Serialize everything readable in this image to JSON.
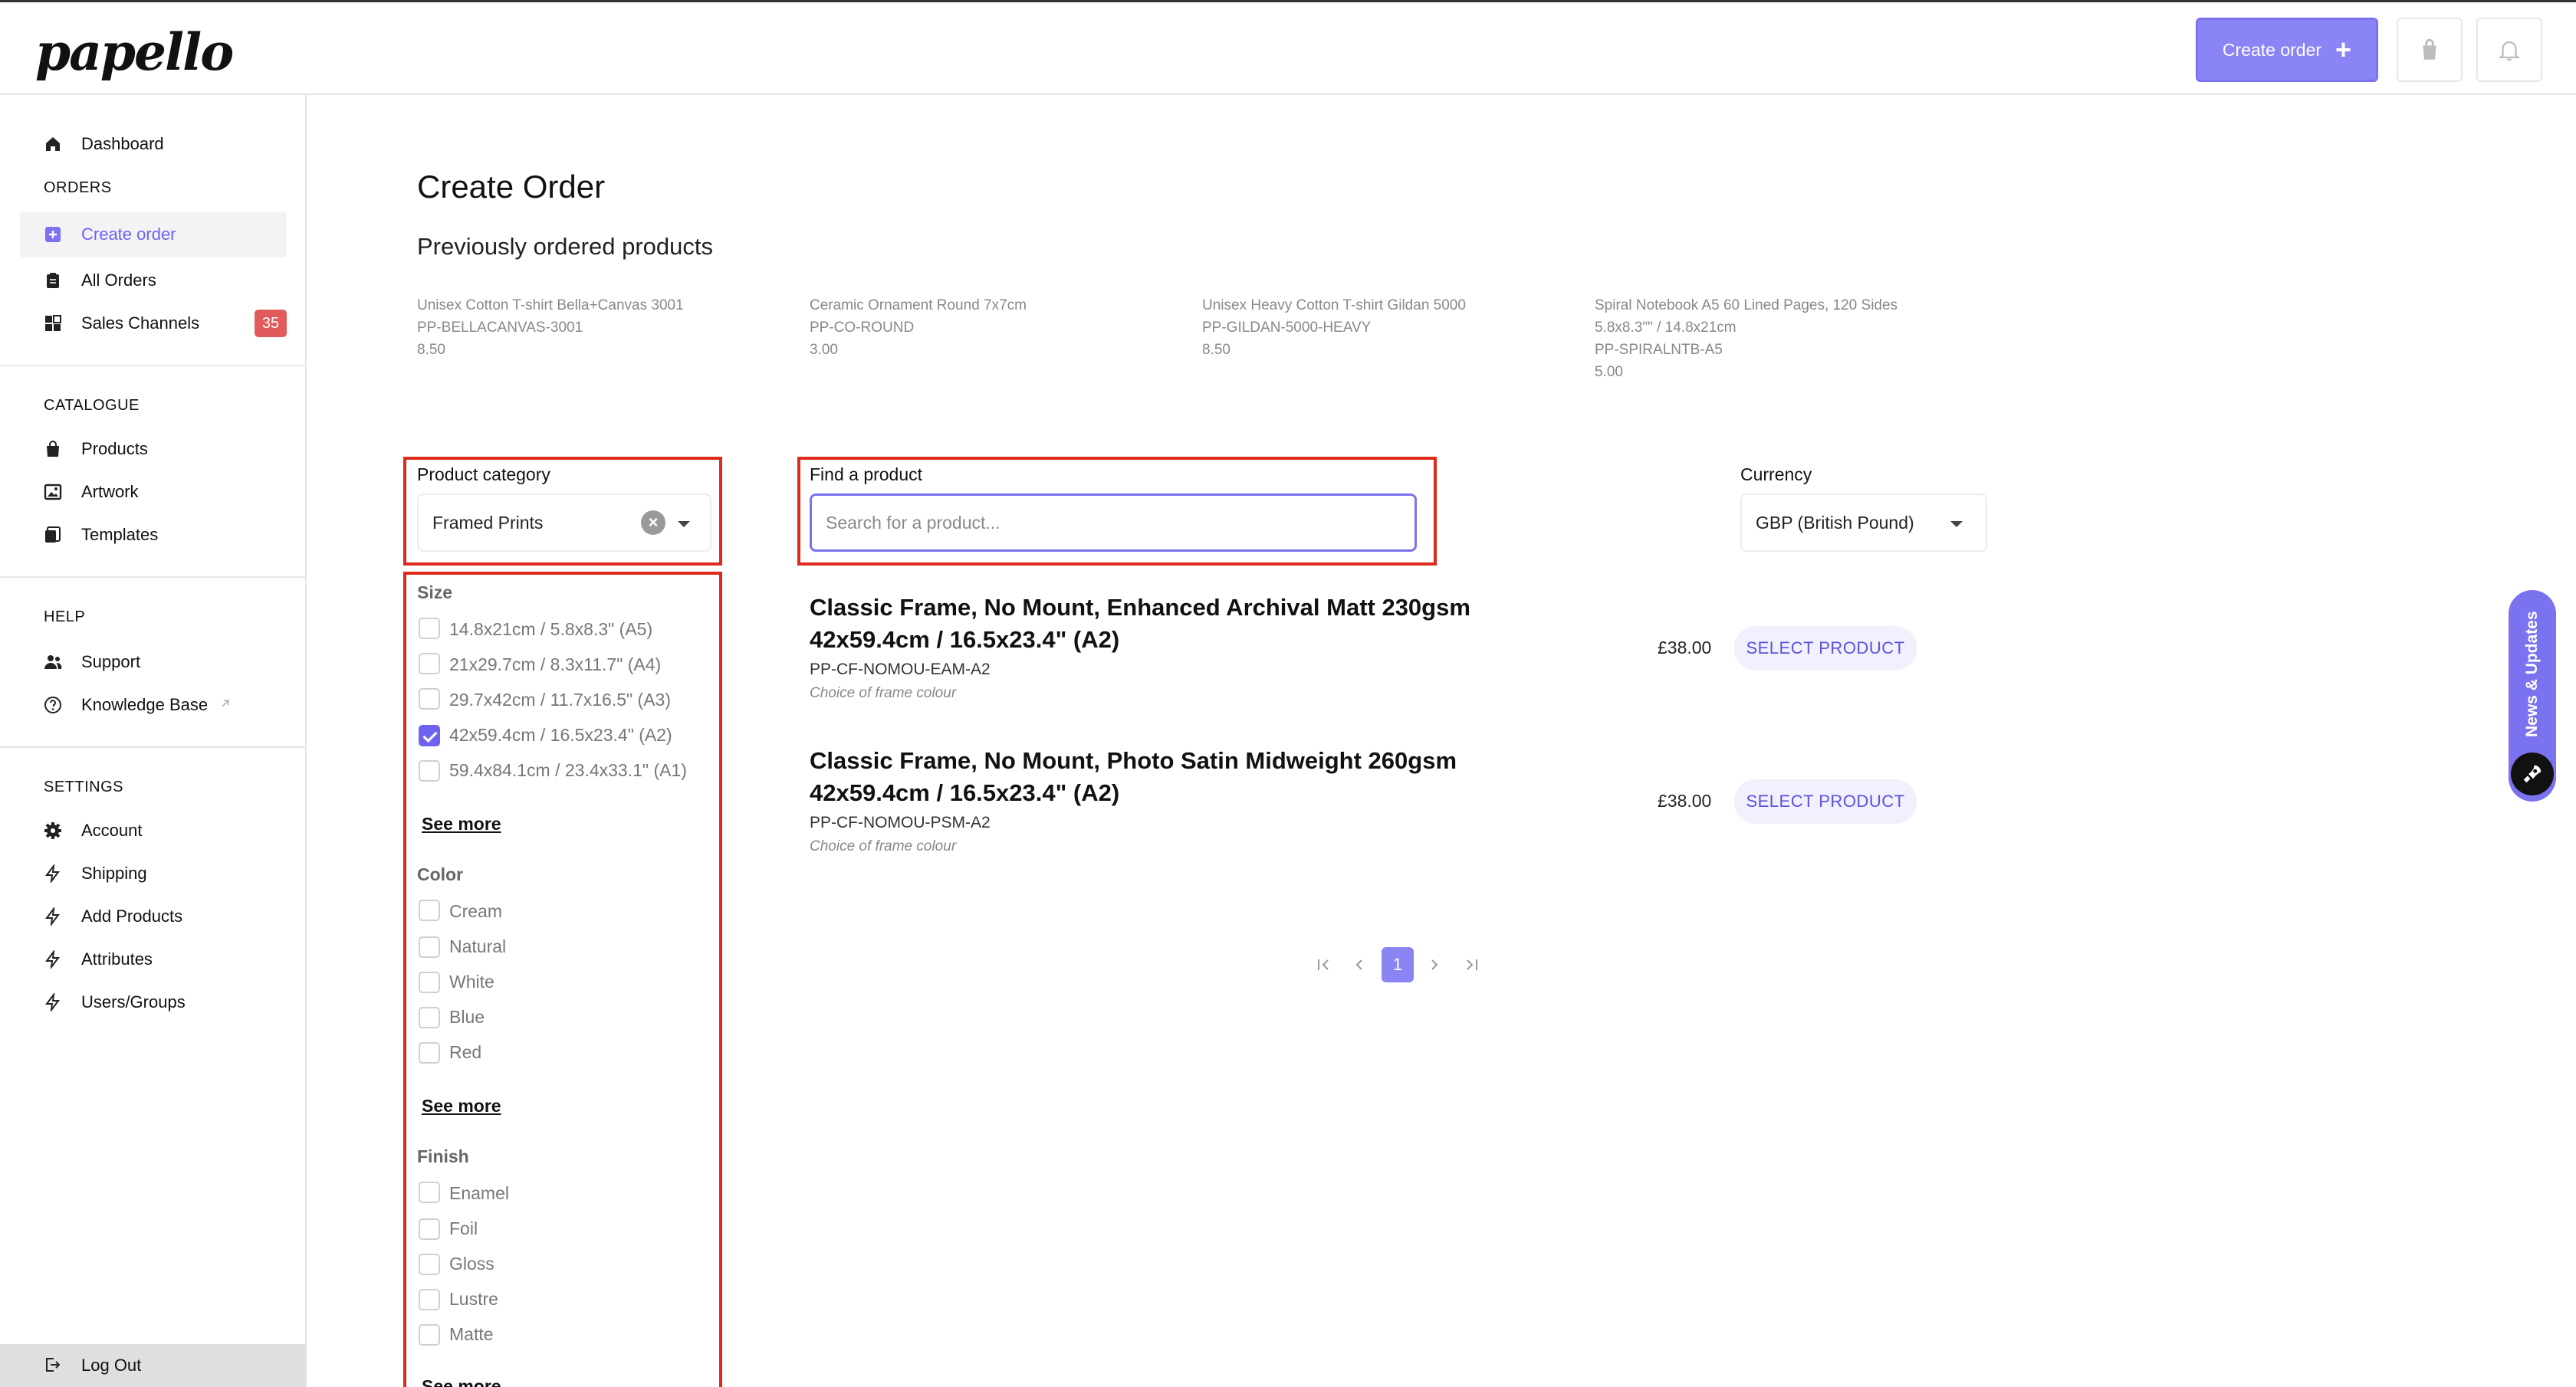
{
  "header": {
    "logo": "papello",
    "create_order_label": "Create order"
  },
  "sidebar": {
    "dashboard": "Dashboard",
    "orders_label": "ORDERS",
    "create_order": "Create order",
    "all_orders": "All Orders",
    "sales_channels": "Sales Channels",
    "sales_channels_badge": "35",
    "catalogue_label": "CATALOGUE",
    "products": "Products",
    "artwork": "Artwork",
    "templates": "Templates",
    "help_label": "HELP",
    "support": "Support",
    "knowledge_base": "Knowledge Base",
    "settings_label": "SETTINGS",
    "account": "Account",
    "shipping": "Shipping",
    "add_products": "Add Products",
    "attributes": "Attributes",
    "users_groups": "Users/Groups",
    "logout": "Log Out"
  },
  "main": {
    "title": "Create Order",
    "previous_title": "Previously ordered products",
    "previous": [
      {
        "name": "Unisex Cotton T-shirt Bella+Canvas 3001",
        "sku": "PP-BELLACANVAS-3001",
        "price": "8.50"
      },
      {
        "name": "Ceramic Ornament Round 7x7cm",
        "sku": "PP-CO-ROUND",
        "price": "3.00"
      },
      {
        "name": "Unisex Heavy Cotton T-shirt Gildan 5000",
        "sku": "PP-GILDAN-5000-HEAVY",
        "price": "8.50"
      },
      {
        "name": "Spiral Notebook A5 60 Lined Pages, 120 Sides",
        "size": "5.8x8.3\"\" / 14.8x21cm",
        "sku": "PP-SPIRALNTB-A5",
        "price": "5.00"
      }
    ],
    "category_label": "Product category",
    "category_value": "Framed Prints",
    "find_label": "Find a product",
    "search_placeholder": "Search for a product...",
    "currency_label": "Currency",
    "currency_value": "GBP (British Pound)"
  },
  "filters": {
    "size_title": "Size",
    "sizes": [
      {
        "label": "14.8x21cm / 5.8x8.3\" (A5)",
        "checked": false
      },
      {
        "label": "21x29.7cm / 8.3x11.7\" (A4)",
        "checked": false
      },
      {
        "label": "29.7x42cm / 11.7x16.5\" (A3)",
        "checked": false
      },
      {
        "label": "42x59.4cm / 16.5x23.4\" (A2)",
        "checked": true
      },
      {
        "label": "59.4x84.1cm / 23.4x33.1\" (A1)",
        "checked": false
      }
    ],
    "see_more": "See more",
    "color_title": "Color",
    "colors": [
      "Cream",
      "Natural",
      "White",
      "Blue",
      "Red"
    ],
    "finish_title": "Finish",
    "finishes": [
      "Enamel",
      "Foil",
      "Gloss",
      "Lustre",
      "Matte"
    ]
  },
  "results": [
    {
      "title_line1": "Classic Frame, No Mount, Enhanced Archival Matt 230gsm",
      "title_line2": "42x59.4cm / 16.5x23.4\" (A2)",
      "sku": "PP-CF-NOMOU-EAM-A2",
      "note": "Choice of frame colour",
      "price": "£38.00",
      "button": "SELECT PRODUCT"
    },
    {
      "title_line1": "Classic Frame, No Mount, Photo Satin Midweight 260gsm",
      "title_line2": "42x59.4cm / 16.5x23.4\" (A2)",
      "sku": "PP-CF-NOMOU-PSM-A2",
      "note": "Choice of frame colour",
      "price": "£38.00",
      "button": "SELECT PRODUCT"
    }
  ],
  "pagination": {
    "current": "1"
  },
  "news": {
    "label": "News & Updates"
  }
}
